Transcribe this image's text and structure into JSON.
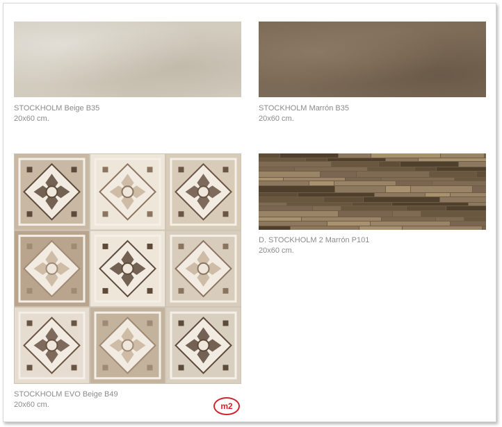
{
  "products": [
    {
      "name": "STOCKHOLM Beige B35",
      "size": "20x60 cm."
    },
    {
      "name": "STOCKHOLM Marrón B35",
      "size": "20x60 cm."
    },
    {
      "name": "STOCKHOLM EVO Beige B49",
      "size": "20x60 cm."
    },
    {
      "name": "D. STOCKHOLM 2 Marrón P101",
      "size": "20x60 cm."
    }
  ],
  "badge": {
    "label": "m2",
    "color": "#d0242b"
  },
  "colors": {
    "beige": "#d2ccbf",
    "marron": "#7b6a57",
    "caption_text": "#8a8a8a"
  }
}
